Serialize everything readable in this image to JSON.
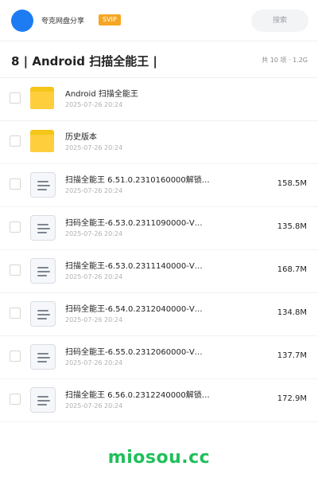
{
  "header": {
    "site_name": "夸克网盘分享",
    "badge": "SVIP",
    "search_placeholder": "搜索",
    "accent": "#1e7cf2"
  },
  "folder": {
    "title": "8 | Android 扫描全能王 |",
    "meta": "共 10 项 · 1.2G"
  },
  "items": [
    {
      "type": "folder",
      "icon": "folder-icon",
      "name": "Android 扫描全能王",
      "date": "2025-07-26 20:24",
      "size": ""
    },
    {
      "type": "folder",
      "icon": "folder-icon",
      "name": "历史版本",
      "date": "2025-07-26 20:24",
      "size": ""
    },
    {
      "type": "file",
      "icon": "file-icon",
      "name": "扫描全能王 6.51.0.2310160000解锁…",
      "date": "2025-07-26 20:24",
      "size": "158.5M"
    },
    {
      "type": "file",
      "icon": "file-icon",
      "name": "扫码全能王-6.53.0.2311090000-V…",
      "date": "2025-07-26 20:24",
      "size": "135.8M"
    },
    {
      "type": "file",
      "icon": "file-icon",
      "name": "扫描全能王-6.53.0.2311140000-V…",
      "date": "2025-07-26 20:24",
      "size": "168.7M"
    },
    {
      "type": "file",
      "icon": "file-icon",
      "name": "扫码全能王-6.54.0.2312040000-V…",
      "date": "2025-07-26 20:24",
      "size": "134.8M"
    },
    {
      "type": "file",
      "icon": "file-icon",
      "name": "扫码全能王-6.55.0.2312060000-V…",
      "date": "2025-07-26 20:24",
      "size": "137.7M"
    },
    {
      "type": "file",
      "icon": "file-icon",
      "name": "扫描全能王 6.56.0.2312240000解锁…",
      "date": "2025-07-26 20:24",
      "size": "172.9M"
    }
  ],
  "watermark": "miosou.cc"
}
